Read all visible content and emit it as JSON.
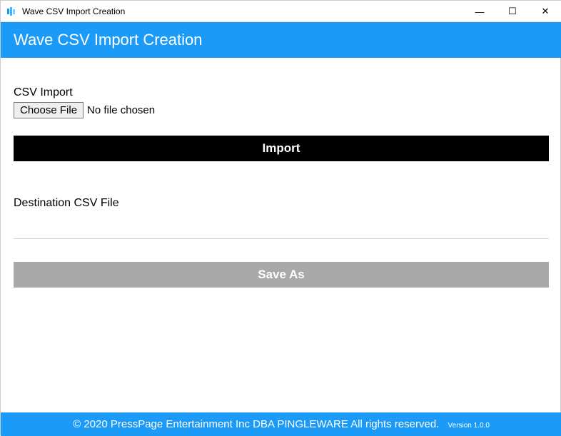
{
  "window": {
    "title": "Wave CSV Import Creation"
  },
  "header": {
    "title": "Wave CSV Import Creation"
  },
  "csv_import": {
    "label": "CSV Import",
    "choose_file_label": "Choose File",
    "file_status": "No file chosen",
    "import_button": "Import"
  },
  "destination": {
    "label": "Destination CSV File",
    "value": "",
    "saveas_button": "Save As"
  },
  "footer": {
    "copyright": "© 2020 PressPage Entertainment Inc DBA PINGLEWARE  All rights reserved.",
    "version": "Version 1.0.0"
  },
  "win_controls": {
    "minimize": "—",
    "maximize": "☐",
    "close": "✕"
  }
}
